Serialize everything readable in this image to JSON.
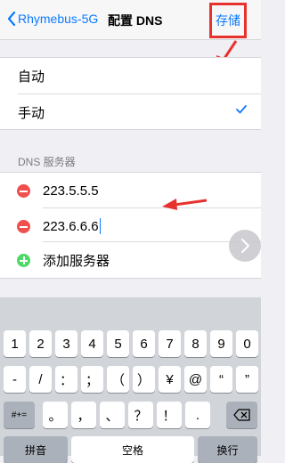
{
  "nav": {
    "back_label": "Rhymebus-5G",
    "title": "配置 DNS",
    "save_label": "存储"
  },
  "mode": {
    "auto_label": "自动",
    "manual_label": "手动",
    "selected": "手动"
  },
  "dns": {
    "section_header": "DNS 服务器",
    "servers": [
      "223.5.5.5",
      "223.6.6.6"
    ],
    "add_label": "添加服务器"
  },
  "keyboard": {
    "row1": [
      "1",
      "2",
      "3",
      "4",
      "5",
      "6",
      "7",
      "8",
      "9",
      "0"
    ],
    "row2": [
      "-",
      "/",
      "：",
      "；",
      "（",
      "）",
      "¥",
      "@",
      "“",
      "”"
    ],
    "row3_left": "#+=",
    "row3_keys": [
      "。",
      "，",
      "、",
      "？",
      "！",
      "."
    ],
    "pinyin": "拼音",
    "space": "空格",
    "return": "换行"
  },
  "colors": {
    "accent": "#0a7aff",
    "delete_red": "#ef4f4e",
    "add_green": "#4cd964",
    "annotation_red": "#e8322e"
  },
  "icons": [
    "chevron-left-icon",
    "checkmark-icon",
    "minus-circle-icon",
    "plus-circle-icon",
    "chevron-right-icon",
    "backspace-icon"
  ]
}
